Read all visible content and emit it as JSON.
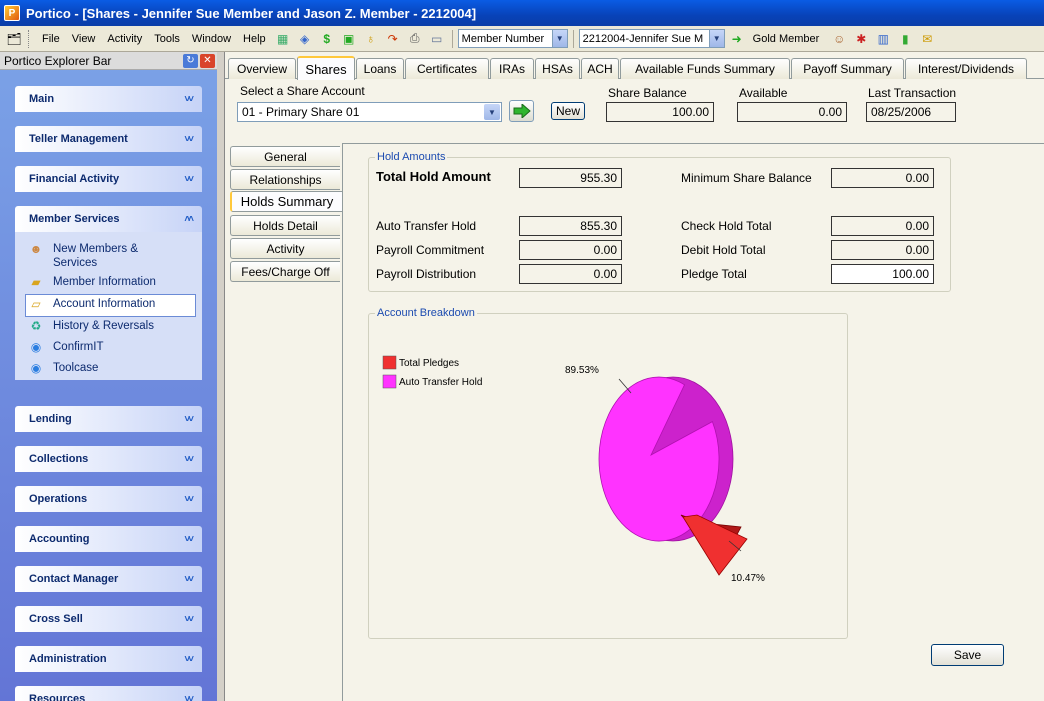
{
  "window": {
    "title": "Portico - [Shares - Jennifer Sue Member and Jason Z. Member - 2212004]"
  },
  "menu": [
    "File",
    "View",
    "Activity",
    "Tools",
    "Window",
    "Help"
  ],
  "toolbar": {
    "search_type": "Member Number",
    "member_select": "2212004-Jennifer Sue M",
    "member_tier": "Gold Member"
  },
  "sidebar": {
    "title": "Portico Explorer Bar",
    "groups": [
      "Main",
      "Teller Management",
      "Financial Activity",
      "Member Services",
      "Lending",
      "Collections",
      "Operations",
      "Accounting",
      "Contact Manager",
      "Cross Sell",
      "Administration",
      "Resources"
    ],
    "member_services_items": [
      {
        "label": "New Members & Services",
        "icon": "people-icon"
      },
      {
        "label": "Member Information",
        "icon": "folder-icon"
      },
      {
        "label": "Account Information",
        "icon": "folder-open-icon"
      },
      {
        "label": "History & Reversals",
        "icon": "recycle-icon"
      },
      {
        "label": "ConfirmIT",
        "icon": "globe-icon"
      },
      {
        "label": "Toolcase",
        "icon": "globe-icon"
      }
    ]
  },
  "tabs": [
    "Overview",
    "Shares",
    "Loans",
    "Certificates",
    "IRAs",
    "HSAs",
    "ACH",
    "Available Funds Summary",
    "Payoff Summary",
    "Interest/Dividends"
  ],
  "share": {
    "select_label": "Select a Share Account",
    "selected": "01 - Primary Share 01",
    "new_label": "New",
    "balance_label": "Share Balance",
    "balance": "100.00",
    "available_label": "Available",
    "available": "0.00",
    "last_txn_label": "Last Transaction",
    "last_txn": "08/25/2006"
  },
  "side_tabs": [
    "General",
    "Relationships",
    "Holds Summary",
    "Holds Detail",
    "Activity",
    "Fees/Charge Off"
  ],
  "hold_amounts": {
    "legend": "Hold Amounts",
    "total_label": "Total Hold Amount",
    "total": "955.30",
    "min_balance_label": "Minimum Share Balance",
    "min_balance": "0.00",
    "auto_transfer_label": "Auto Transfer Hold",
    "auto_transfer": "855.30",
    "check_hold_label": "Check Hold Total",
    "check_hold": "0.00",
    "payroll_commit_label": "Payroll Commitment",
    "payroll_commit": "0.00",
    "debit_hold_label": "Debit Hold Total",
    "debit_hold": "0.00",
    "payroll_dist_label": "Payroll Distribution",
    "payroll_dist": "0.00",
    "pledge_label": "Pledge Total",
    "pledge": "100.00"
  },
  "breakdown": {
    "legend": "Account Breakdown"
  },
  "chart_data": {
    "type": "pie",
    "title": "",
    "slices": [
      {
        "name": "Total Pledges",
        "value": 10.47,
        "label": "10.47%",
        "color": "#f03030"
      },
      {
        "name": "Auto Transfer Hold",
        "value": 89.53,
        "label": "89.53%",
        "color": "#ff33ff"
      }
    ],
    "legend_position": "top-left"
  },
  "save_label": "Save",
  "colors": {
    "accent": "#1c4bb0",
    "tab_highlight": "#ffc83c"
  }
}
